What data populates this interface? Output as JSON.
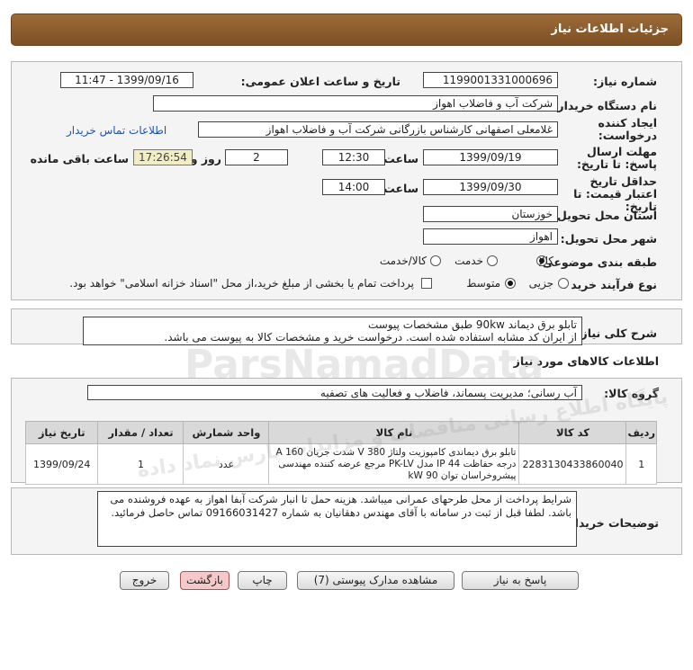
{
  "header": {
    "title": "جزئیات اطلاعات نیاز"
  },
  "form": {
    "need_number_label": "شماره نیاز:",
    "need_number": "1199001331000696",
    "announce_label": "تاریخ و ساعت اعلان عمومی:",
    "announce_value": "1399/09/16 - 11:47",
    "buyer_org_label": "نام دستگاه خریدار:",
    "buyer_org": "شرکت آب و فاضلاب اهواز",
    "creator_label": "ایجاد کننده درخواست:",
    "creator": "غلامعلی اصفهانی کارشناس بازرگانی شرکت آب و فاضلاب اهواز",
    "contact_link": "اطلاعات تماس خریدار",
    "deadline_label": "مهلت ارسال پاسخ: تا تاریخ:",
    "deadline_date": "1399/09/19",
    "time_label": "ساعت",
    "deadline_time": "12:30",
    "days_value": "2",
    "days_label": "روز و",
    "countdown": "17:26:54",
    "remaining_label": "ساعت باقی مانده",
    "validity_label": "حداقل تاریخ اعتبار قیمت: تا تاریخ:",
    "validity_date": "1399/09/30",
    "validity_time_label": "ساعت",
    "validity_time": "14:00",
    "province_label": "استان محل تحویل:",
    "province": "خوزستان",
    "city_label": "شهر محل تحویل:",
    "city": "اهواز",
    "category_label": "طبقه بندی موضوعی:",
    "category_options": [
      "کالا",
      "خدمت",
      "کالا/خدمت"
    ],
    "category_selected": "کالا",
    "process_label": "نوع فرآیند خرید :",
    "process_options": [
      "جزیی",
      "متوسط"
    ],
    "process_selected": "متوسط",
    "payment_note": "پرداخت تمام یا بخشی از مبلغ خرید،از محل \"اسناد خزانه اسلامی\" خواهد بود."
  },
  "description": {
    "label": "شرح کلی نیاز:",
    "line1": "تابلو برق دیماند 90kw طبق مشخصات پیوست",
    "line2": "از ایران کد مشابه استفاده شده است. درخواست خرید و مشخصات کالا به پیوست می باشد."
  },
  "goods": {
    "section_title": "اطلاعات کالاهای مورد نیاز",
    "group_label": "گروه کالا:",
    "group_value": "آب رسانی؛ مدیریت پسماند، فاضلاب و فعالیت های تصفیه",
    "columns": [
      "ردیف",
      "کد کالا",
      "نام کالا",
      "واحد شمارش",
      "تعداد / مقدار",
      "تاریخ نیاز"
    ],
    "rows": [
      {
        "row": "1",
        "code": "2283130433860040",
        "name": "تابلو برق دیماندی کامپوزیت ولتاژ 380 V شدت جریان 160 A درجه حفاظت IP 44 مدل PK-LV مرجع عرضه کننده مهندسی پیشروخراسان توان 90 kW",
        "unit": "عدد",
        "qty": "1",
        "date": "1399/09/24"
      }
    ]
  },
  "buyer_notes": {
    "label": "توضیحات خریدار:",
    "text": "شرایط پرداخت از محل طرحهای عمرانی میباشد. هزینه حمل تا  انبار شرکت آبفا اهواز به عهده فروشنده می باشد. لطفا قبل از ثبت در سامانه با آقای مهندس دهقانیان به شماره 09166031427 تماس حاصل فرمائید."
  },
  "buttons": {
    "reply": "پاسخ به نیاز",
    "attachments": "مشاهده مدارک پیوستی (7)",
    "print": "چاپ",
    "back": "بازگشت",
    "exit": "خروج"
  },
  "watermark": {
    "brand": "ParsNamadData",
    "persian": "پایگاه اطلاع رسانی مناقصات و مزایدات پارس نماد داده"
  },
  "colors": {
    "header": "#8b5a2b",
    "timer_bg": "#f2edc2",
    "link": "#1f52b0"
  }
}
